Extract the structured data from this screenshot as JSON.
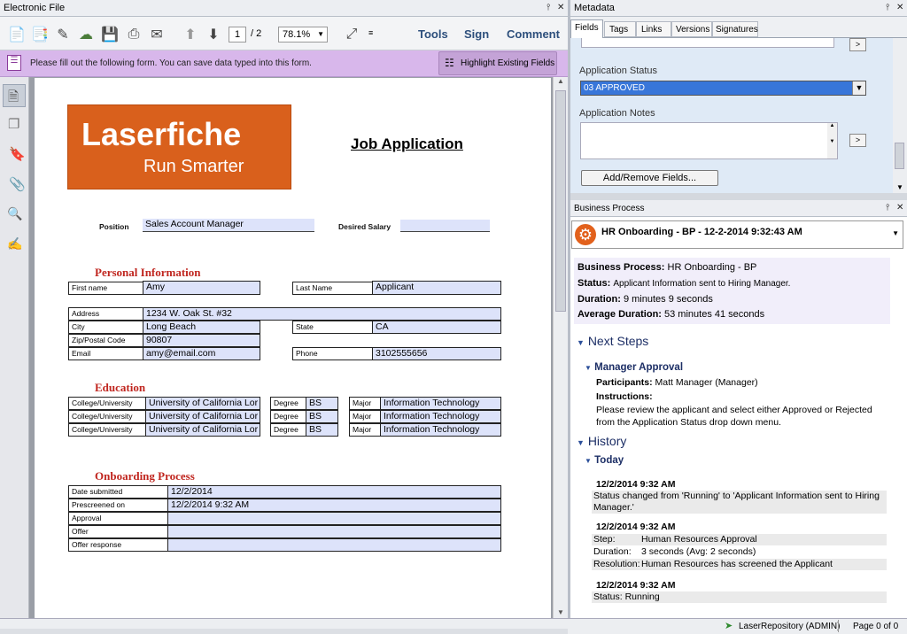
{
  "left_panel": {
    "title": "Electronic File"
  },
  "toolbar": {
    "page_current": "1",
    "page_total": "/ 2",
    "zoom": "78.1%",
    "tools": "Tools",
    "sign": "Sign",
    "comment": "Comment"
  },
  "form_bar": {
    "message": "Please fill out the following form. You can save data typed into this form.",
    "highlight": "Highlight Existing Fields"
  },
  "doc": {
    "logo_line1": "Laserfiche",
    "logo_line2": "Run Smarter",
    "title": "Job Application",
    "position_label": "Position",
    "position": "Sales Account Manager",
    "salary_label": "Desired Salary",
    "personal": "Personal Information",
    "first_name_label": "First name",
    "first_name": "Amy",
    "last_name_label": "Last Name",
    "last_name": "Applicant",
    "address_label": "Address",
    "address": "1234 W. Oak St. #32",
    "city_label": "City",
    "city": "Long Beach",
    "state_label": "State",
    "state": "CA",
    "zip_label": "Zip/Postal Code",
    "zip": "90807",
    "email_label": "Email",
    "email": "amy@email.com",
    "phone_label": "Phone",
    "phone": "3102555656",
    "education": "Education",
    "edu_rows": [
      {
        "c": "College/University",
        "cv": "University of California Lor",
        "d": "Degree",
        "dv": "BS",
        "m": "Major",
        "mv": "Information Technology"
      },
      {
        "c": "College/University",
        "cv": "University of California Lor",
        "d": "Degree",
        "dv": "BS",
        "m": "Major",
        "mv": "Information Technology"
      },
      {
        "c": "College/University",
        "cv": "University of California Lor",
        "d": "Degree",
        "dv": "BS",
        "m": "Major",
        "mv": "Information Technology"
      }
    ],
    "onboarding": "Onboarding Process",
    "onb_rows": [
      {
        "label": "Date submitted",
        "value": "12/2/2014"
      },
      {
        "label": "Prescreened on",
        "value": "12/2/2014 9:32 AM"
      },
      {
        "label": "Approval",
        "value": ""
      },
      {
        "label": "Offer",
        "value": ""
      },
      {
        "label": "Offer response",
        "value": ""
      }
    ]
  },
  "metadata": {
    "title": "Metadata",
    "tabs": [
      "Fields",
      "Tags",
      "Links",
      "Versions",
      "Signatures"
    ],
    "status_label": "Application Status",
    "status_value": "03 APPROVED",
    "notes_label": "Application Notes",
    "add_remove": "Add/Remove Fields..."
  },
  "bp": {
    "title": "Business Process",
    "selector": "HR Onboarding - BP - 12-2-2014 9:32:43 AM",
    "process_label": "Business Process:",
    "process": "HR Onboarding - BP",
    "status_label": "Status:",
    "status": "Applicant Information sent to Hiring Manager.",
    "duration_label": "Duration:",
    "duration": "9 minutes 9 seconds",
    "avg_label": "Average Duration:",
    "avg": "53 minutes 41 seconds",
    "next_steps": "Next Steps",
    "step_name": "Manager Approval",
    "participants_label": "Participants:",
    "participants": "Matt Manager (Manager)",
    "instructions_label": "Instructions:",
    "instructions": "Please review the applicant and select either Approved or Rejected from the Application Status drop down menu.",
    "history": "History",
    "today": "Today",
    "h1_time": "12/2/2014 9:32 AM",
    "h1_text": "Status changed from 'Running' to 'Applicant Information sent to Hiring Manager.'",
    "h2_time": "12/2/2014 9:32 AM",
    "h2_step_l": "Step:",
    "h2_step": "Human Resources Approval",
    "h2_dur_l": "Duration:",
    "h2_dur": "3 seconds (Avg: 2 seconds)",
    "h2_res_l": "Resolution:",
    "h2_res": "Human Resources has screened the Applicant",
    "h3_time": "12/2/2014 9:32 AM",
    "h3_text": "Status: Running"
  },
  "status_bar": {
    "repo": "LaserRepository (ADMIN)",
    "page": "Page 0 of 0"
  }
}
